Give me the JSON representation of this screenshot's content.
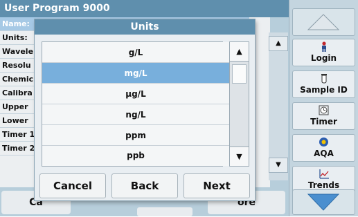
{
  "background": {
    "title": "User Program 9000",
    "rows": [
      "Name:",
      "Units:",
      "Wavele",
      "Resolu",
      "Chemic",
      "Calibra",
      "Upper",
      "Lower",
      "Timer 1",
      "Timer 2"
    ],
    "scroll_up": "▲",
    "scroll_down": "▼",
    "bottom_left_label": "Ca",
    "bottom_right_label": "ore"
  },
  "dialog": {
    "title": "Units",
    "options": [
      "g/L",
      "mg/L",
      "µg/L",
      "ng/L",
      "ppm",
      "ppb"
    ],
    "selected_index": 1,
    "scroll_up": "▲",
    "scroll_down": "▼",
    "buttons": {
      "cancel": "Cancel",
      "back": "Back",
      "next": "Next"
    }
  },
  "sidebar": {
    "buttons": [
      {
        "label": "Login",
        "icon": "person-icon"
      },
      {
        "label": "Sample ID",
        "icon": "vial-icon"
      },
      {
        "label": "Timer",
        "icon": "timer-icon"
      },
      {
        "label": "AQA",
        "icon": "aqa-icon"
      },
      {
        "label": "Trends",
        "icon": "trends-icon"
      }
    ]
  },
  "colors": {
    "title_bar": "#5f8fad",
    "selected": "#78afdc",
    "panel": "#b7cedb"
  }
}
